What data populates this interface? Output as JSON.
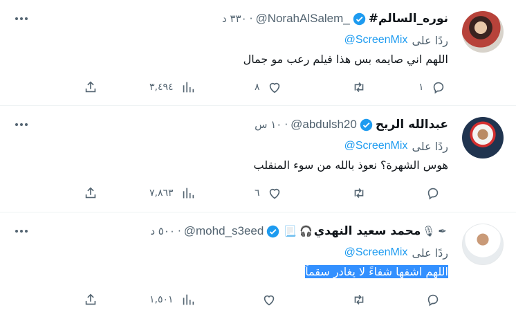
{
  "reply_prefix": "ردًا على",
  "tweets": [
    {
      "name": "#نوره_السالم",
      "handle": "@NorahAlSalem_",
      "time": "٣٣٠ د",
      "mention": "@ScreenMix",
      "text": "اللهم اني صايمه بس هذا فيلم رعب مو جمال",
      "replies": "١",
      "retweets": "",
      "likes": "٨",
      "views": "٣,٤٩٤"
    },
    {
      "name": "عبدالله الريح",
      "handle": "@abdulsh20",
      "time": "١٠ س",
      "mention": "@ScreenMix",
      "text": "هوس الشهرة؟ نعوذ بالله من سوء المنقلب",
      "replies": "",
      "retweets": "",
      "likes": "٦",
      "views": "٧,٨٦٣"
    },
    {
      "name": "محمد سعيد النهدي",
      "name_emoji_left": "🎧",
      "name_emoji_right": "🎙",
      "name_emoji_pen": "✒",
      "name_emoji_doc": "📃",
      "handle": "@mohd_s3eed",
      "time": "٥٠٠ د",
      "mention": "@ScreenMix",
      "text": "اللهم اشفها شفاءً لا يغادر سقماً",
      "replies": "",
      "retweets": "",
      "likes": "",
      "views": "١,٥٠١"
    }
  ],
  "colors": {
    "accent": "#1d9bf0",
    "muted": "#536471",
    "selection": "#3390ff"
  }
}
